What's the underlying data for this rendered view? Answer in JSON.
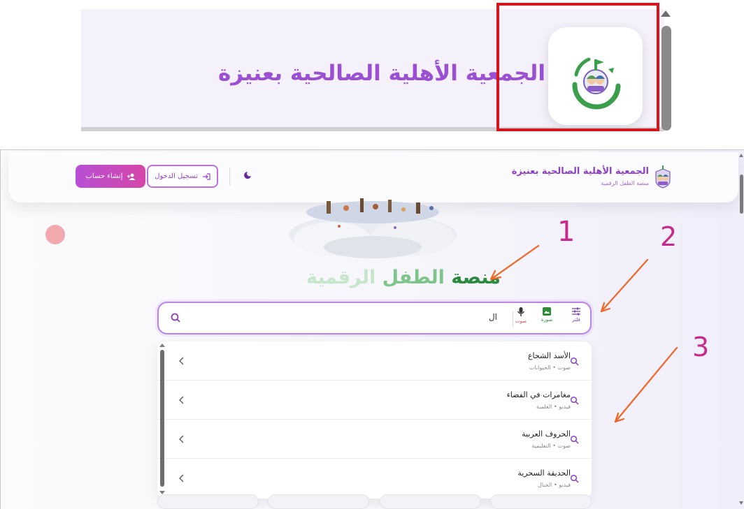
{
  "zoom": {
    "title": "الجمعية الأهلية الصالحية بعنيزة"
  },
  "header": {
    "brand_title": "الجمعية الأهلية الصالحية بعنيزة",
    "brand_subtitle": "منصة الطفل الرقمية",
    "login_label": "تسجيل الدخول",
    "create_account_label": "إنشاء حساب"
  },
  "hero": {
    "title_part1": "منصة",
    "title_part2": "الطفل",
    "title_part3": "الرقمية"
  },
  "search": {
    "value": "ال",
    "tools": {
      "filter": "فلتر",
      "image": "صورة",
      "voice": "صوت"
    }
  },
  "suggestions": [
    {
      "title": "الأسد الشجاع",
      "meta": "صوت • الحيوانات"
    },
    {
      "title": "مغامرات في الفضاء",
      "meta": "فيديو • العلمية"
    },
    {
      "title": "الحروف العربية",
      "meta": "صوت • التعليمية"
    },
    {
      "title": "الحديقة السحرية",
      "meta": "فيديو • الخيال"
    }
  ],
  "annotations": {
    "label_1": "1",
    "label_2": "2",
    "label_3": "3"
  },
  "colors": {
    "brand_purple": "#8d3fc6",
    "accent_pink": "#d546a7",
    "hero_green": "#2c8a3e",
    "highlight_red": "#d8151f",
    "annotation_orange": "#f26522"
  }
}
